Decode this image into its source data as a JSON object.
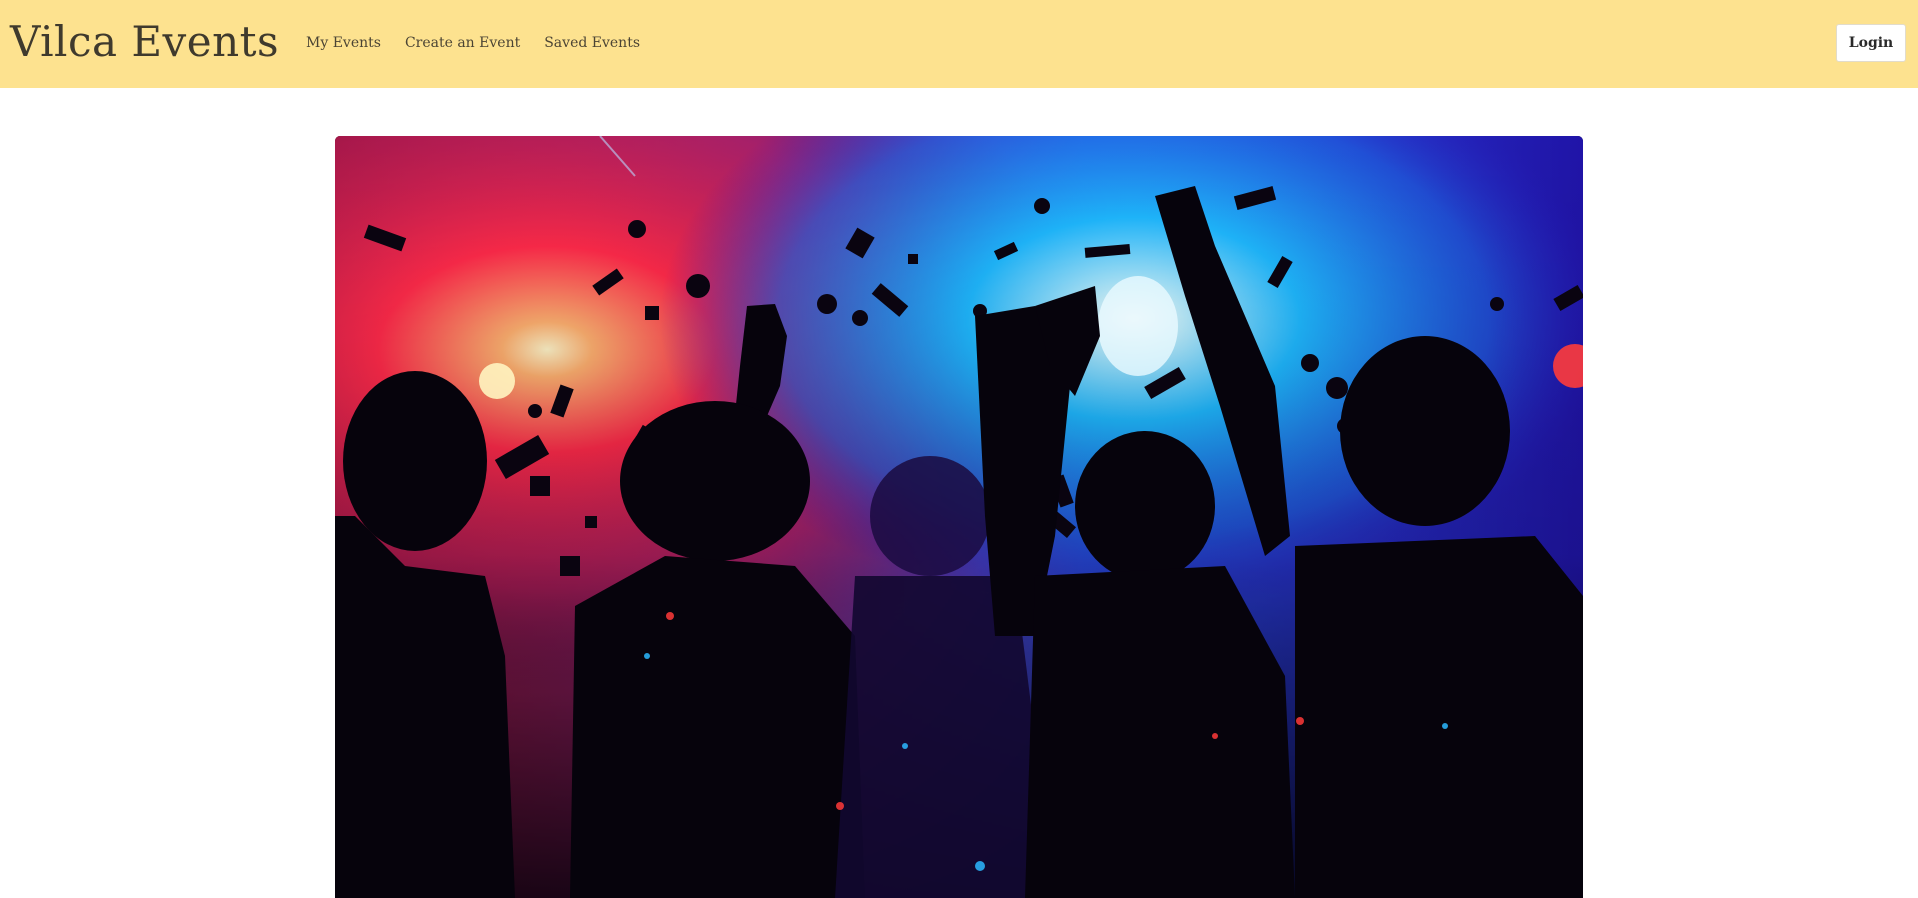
{
  "navbar": {
    "brand": "Vilca Events",
    "links": [
      {
        "label": "My Events"
      },
      {
        "label": "Create an Event"
      },
      {
        "label": "Saved Events"
      }
    ],
    "login_label": "Login",
    "background_color": "#fde28f"
  },
  "hero": {
    "image_subject": "party-crowd-silhouettes-with-confetti",
    "glow_colors": [
      "#ff2a4a",
      "#1fb8ff",
      "#3a1fd8"
    ]
  }
}
